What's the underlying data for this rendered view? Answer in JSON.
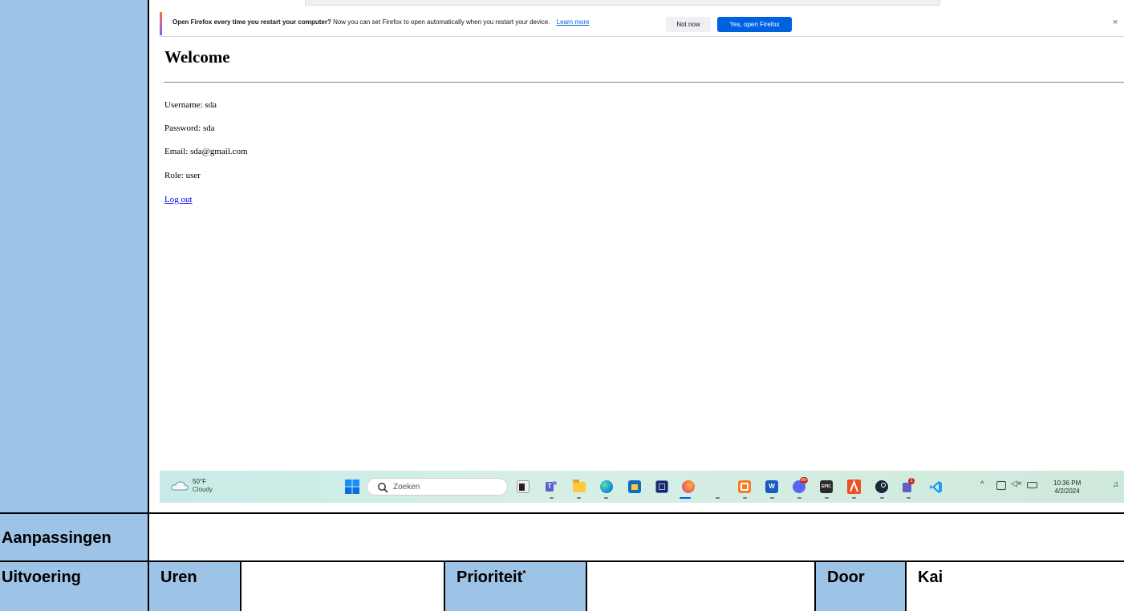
{
  "browser": {
    "notification": {
      "bold_text": "Open Firefox every time you restart your computer?",
      "text": "Now you can set Firefox to open automatically when you restart your device.",
      "learn_more": "Learn more",
      "not_now": "Not now",
      "yes": "Yes, open Firefox",
      "close": "×"
    },
    "page": {
      "heading": "Welcome",
      "username": "Username: sda",
      "password": "Password: sda",
      "email": "Email: sda@gmail.com",
      "role": "Role: user",
      "logout": "Log out"
    }
  },
  "taskbar": {
    "weather_temp": "50°F",
    "weather_cond": "Cloudy",
    "search_placeholder": "Zoeken",
    "time": "10:36 PM",
    "date": "4/2/2024",
    "apps": [
      "task-view",
      "teams",
      "file-explorer",
      "edge",
      "store",
      "notion",
      "firefox",
      "xampp",
      "word",
      "discord",
      "epic-games",
      "git",
      "steam",
      "teams-work",
      "vscode"
    ],
    "discord_badge": "99+",
    "teams_badge": "1"
  },
  "document": {
    "row_aanpassingen": "Aanpassingen",
    "uitvoering": "Uitvoering",
    "uren": "Uren",
    "prioriteit": "Prioriteit",
    "prioriteit_mark": "*",
    "door": "Door",
    "door_value": "Kai"
  }
}
